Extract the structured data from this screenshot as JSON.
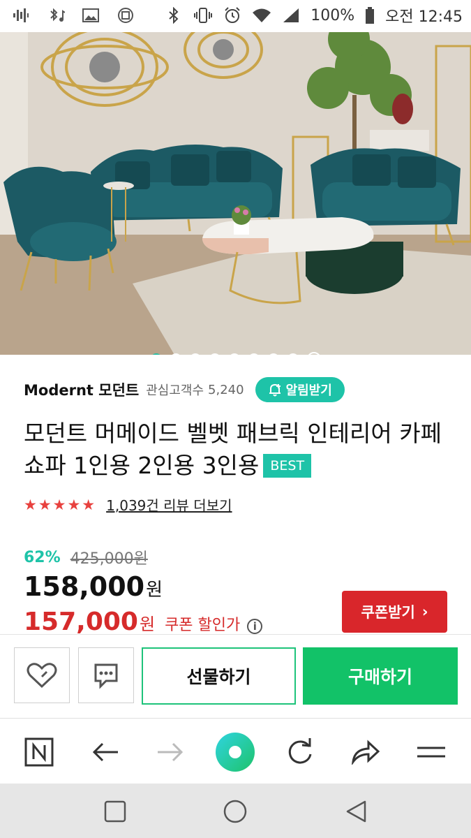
{
  "status_bar": {
    "battery": "100%",
    "time": "오전 12:45"
  },
  "hero": {
    "carousel_pages": 8,
    "active_page": 1
  },
  "store": {
    "name": "Modernt 모던트",
    "follow_label": "관심고객수",
    "follow_count": "5,240",
    "alarm_label": "알림받기"
  },
  "product": {
    "title": "모던트 머메이드 벨벳 패브릭 인테리어 카페 쇼파 1인용 2인용 3인용",
    "badge": "BEST",
    "rating_stars": 5,
    "review_text": "1,039건 리뷰 더보기"
  },
  "pricing": {
    "discount_rate": "62%",
    "original_price": "425,000원",
    "price": "158,000",
    "price_unit": "원",
    "coupon_price": "157,000",
    "coupon_unit": "원",
    "coupon_label": "쿠폰 할인가",
    "coupon_button": "쿠폰받기"
  },
  "actions": {
    "gift_label": "선물하기",
    "buy_label": "구매하기"
  },
  "colors": {
    "accent": "#1ec3a8",
    "buy_green": "#12c268",
    "sale_red": "#d62b2b"
  }
}
